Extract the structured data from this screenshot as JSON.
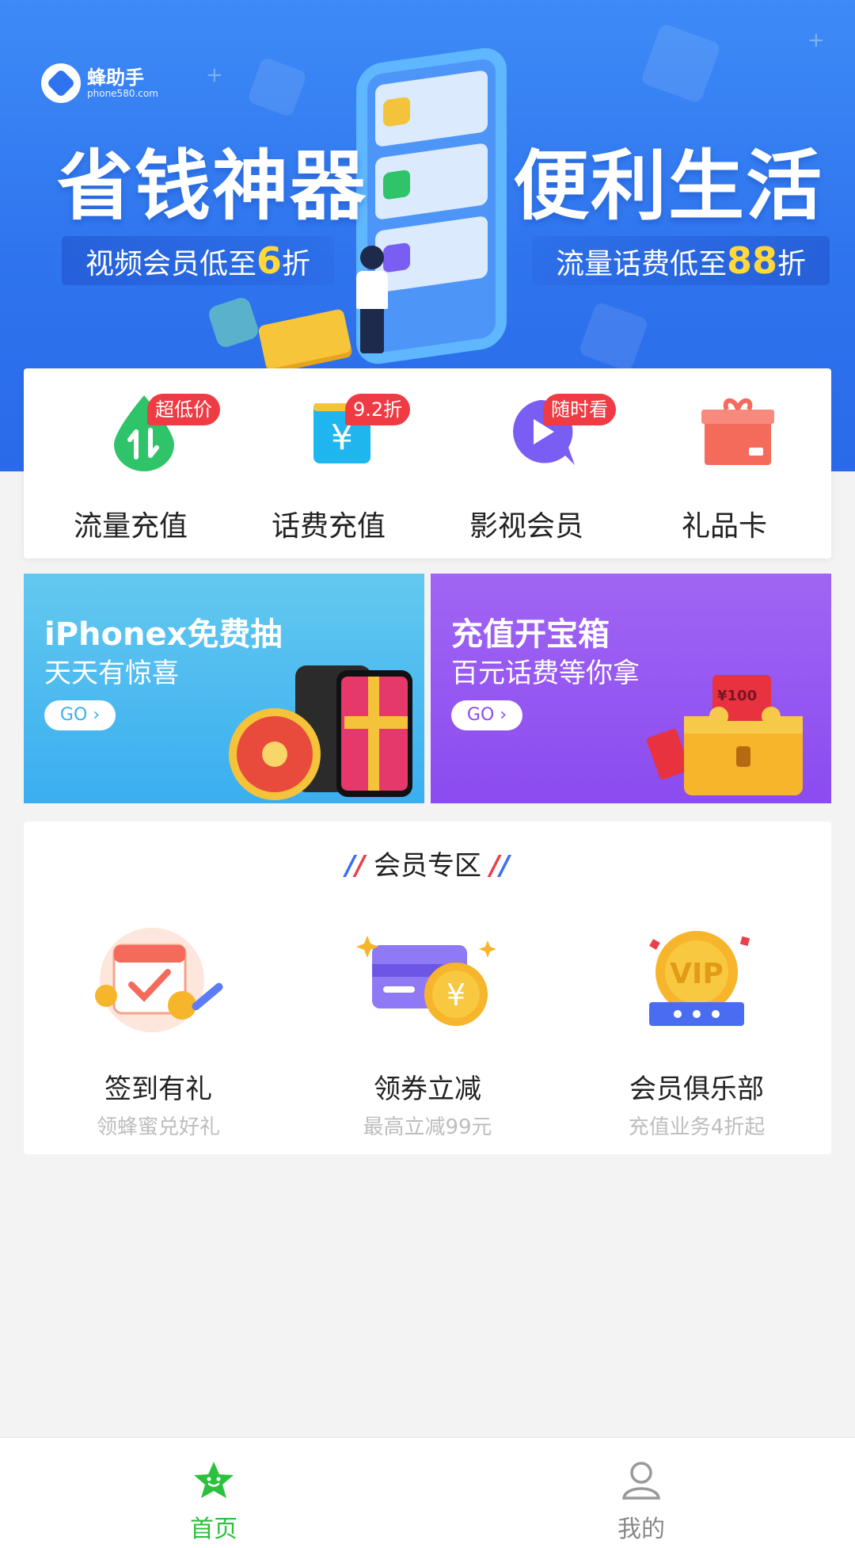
{
  "hero": {
    "logo_name": "蜂助手",
    "logo_url": "phone580.com",
    "title_left": "省钱神器",
    "title_right": "便利生活",
    "pill_left_text": "视频会员低至",
    "pill_left_num": "6",
    "pill_left_unit": "折",
    "pill_right_text": "流量话费低至",
    "pill_right_num": "88",
    "pill_right_unit": "折"
  },
  "categories": [
    {
      "label": "流量充值",
      "badge": "超低价",
      "icon": "data-drop-icon",
      "color": "#2fc46a"
    },
    {
      "label": "话费充值",
      "badge": "9.2折",
      "icon": "yuan-card-icon",
      "color": "#1fb6f0"
    },
    {
      "label": "影视会员",
      "badge": "随时看",
      "icon": "play-bubble-icon",
      "color": "#7a5df2"
    },
    {
      "label": "礼品卡",
      "badge": "",
      "icon": "gift-box-icon",
      "color": "#f46b5b"
    }
  ],
  "promos": [
    {
      "title": "iPhonex免费抽",
      "subtitle": "天天有惊喜",
      "go": "GO",
      "color": "#3aaef0"
    },
    {
      "title": "充值开宝箱",
      "subtitle": "百元话费等你拿",
      "go": "GO",
      "color": "#8b4bf0",
      "coupon": "¥100"
    }
  ],
  "member": {
    "title": "会员专区",
    "items": [
      {
        "label": "签到有礼",
        "sub": "领蜂蜜兑好礼",
        "icon": "calendar-checkin-icon"
      },
      {
        "label": "领券立减",
        "sub": "最高立减99元",
        "icon": "coupon-yuan-icon"
      },
      {
        "label": "会员俱乐部",
        "sub": "充值业务4折起",
        "icon": "vip-medal-icon"
      }
    ]
  },
  "nav": {
    "home": "首页",
    "mine": "我的",
    "active_color": "#2bc03d"
  }
}
